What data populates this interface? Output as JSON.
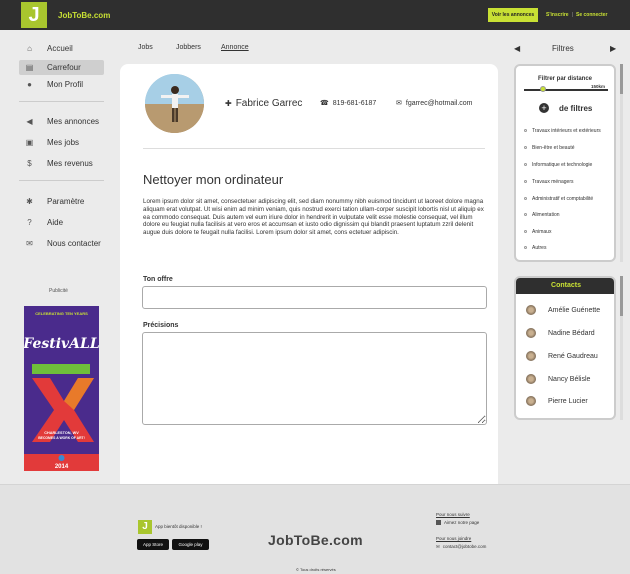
{
  "header": {
    "logo_letter": "J",
    "brand": "JobToBe.com",
    "cta": "Voir les annonces",
    "signup": "S'inscrire",
    "separator": "|",
    "login": "Se connecter"
  },
  "sidebar": {
    "items": [
      {
        "label": "Accueil",
        "icon": "home-icon",
        "glyph": "⌂"
      },
      {
        "label": "Carrefour",
        "icon": "calendar-icon",
        "glyph": "▤",
        "active": true
      },
      {
        "label": "Mon Profil",
        "icon": "user-icon",
        "glyph": "●"
      },
      {
        "label": "Mes annonces",
        "icon": "megaphone-icon",
        "glyph": "◀"
      },
      {
        "label": "Mes jobs",
        "icon": "briefcase-icon",
        "glyph": "▣"
      },
      {
        "label": "Mes revenus",
        "icon": "money-icon",
        "glyph": "$"
      },
      {
        "label": "Paramètre",
        "icon": "gear-icon",
        "glyph": "✱"
      },
      {
        "label": "Aide",
        "icon": "help-icon",
        "glyph": "?"
      },
      {
        "label": "Nous contacter",
        "icon": "mail-icon",
        "glyph": "✉"
      }
    ],
    "ad_label": "Publicité",
    "ad": {
      "line1": "CELEBRATING TEN YEARS",
      "title": "FestivALL",
      "line2": "CHARLESTON, WV",
      "line3": "BECOMES A WORK OF ART!",
      "year": "2014"
    }
  },
  "tabs": [
    "Jobs",
    "Jobbers",
    "Annonce"
  ],
  "active_tab": "Annonce",
  "profile": {
    "name": "Fabrice Garrec",
    "phone": "819-681-6187",
    "email": "fgarrec@hotmail.com"
  },
  "task": {
    "title": "Nettoyer mon ordinateur",
    "description": "Lorem ipsum dolor sit amet, consectetuer adipiscing elit, sed diam nonummy nibh euismod tincidunt ut laoreet dolore magna aliquam erat volutpat. Ut wisi enim ad minim veniam, quis nostrud exerci tation ullam-corper suscipit lobortis nisl ut aliquip ex ea commodo consequat. Duis autem vel eum iriure dolor in hendrerit in vulputate velit esse molestie consequat, vel illum dolore eu feugiat nulla facilisis at vero eros et accumsan et iusto odio dignissim qui blandit praesent luptatum zzril delenit augue duis dolore te feugait nulla facilisi. Lorem ipsum dolor sit amet, cons ectetuer adipiscin."
  },
  "form": {
    "offer_label": "Ton offre",
    "offer_value": "",
    "details_label": "Précisions",
    "details_value": ""
  },
  "filters": {
    "title": "Filtres",
    "distance_label": "Filtrer par distance",
    "distance_value": "150km",
    "distance_fraction": 0.23,
    "more_label": "de filtres",
    "categories": [
      "Travaux intérieurs et extérieurs",
      "Bien-être et beauté",
      "Informatique et technologie",
      "Travaux ménagers",
      "Administratif et comptabilité",
      "Alimentation",
      "Animaux",
      "Autres"
    ]
  },
  "contacts": {
    "title": "Contacts",
    "items": [
      "Amélie Guénette",
      "Nadine Bédard",
      "René Gaudreau",
      "Nancy Bélisle",
      "Pierre Lucier"
    ]
  },
  "footer": {
    "logo_letter": "J",
    "app_text": "App bientôt disponible !",
    "app_store": "App Store",
    "google_play": "Google play",
    "brand": "JobToBe.com",
    "follow_label": "Pour nous suivre",
    "like_label": "Aimez notre page",
    "join_label": "Pour nous joindre",
    "email": "contact@jobtobe.com",
    "rights": "© Tous droits réservés"
  },
  "colors": {
    "accent": "#c8e034",
    "logo_green": "#a9c62e",
    "dark": "#2f2f2f",
    "ad_purple": "#4a2b8c",
    "ad_orange": "#e87a2a",
    "ad_red": "#e23a3a"
  }
}
